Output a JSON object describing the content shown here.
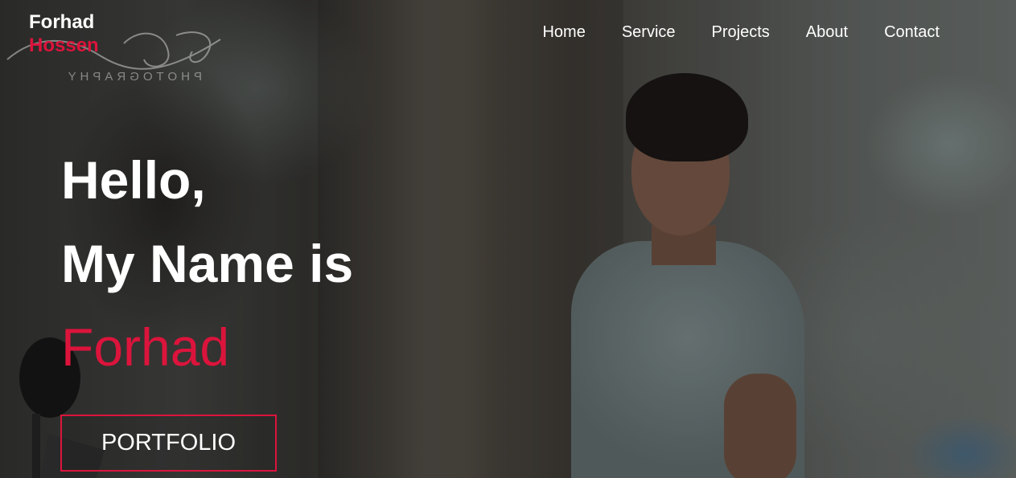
{
  "logo": {
    "first_name": "Forhad",
    "last_name": "Hossen",
    "watermark_text": "PHOTOGRAPHY"
  },
  "nav": {
    "items": [
      {
        "label": "Home"
      },
      {
        "label": "Service"
      },
      {
        "label": "Projects"
      },
      {
        "label": "About"
      },
      {
        "label": "Contact"
      }
    ]
  },
  "hero": {
    "line1": "Hello,",
    "line2": "My Name is",
    "name": "Forhad",
    "cta_label": "PORTFOLIO"
  },
  "colors": {
    "accent": "#dc143c",
    "text": "#ffffff"
  }
}
